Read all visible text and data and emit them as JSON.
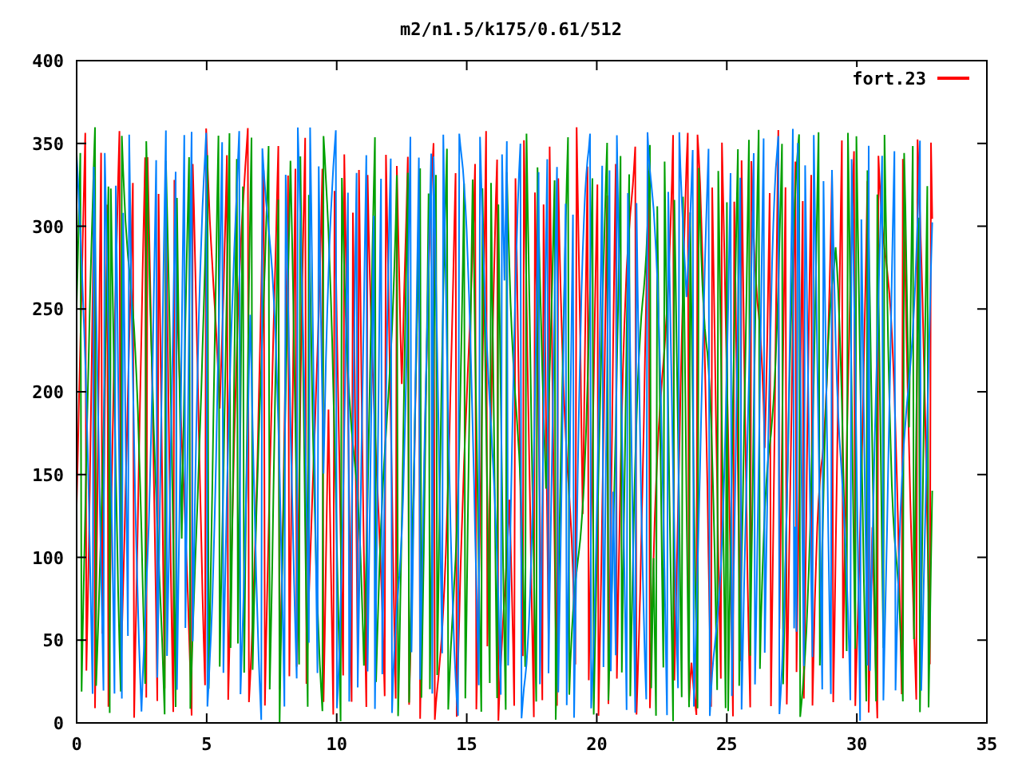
{
  "title": "m2/n1.5/k175/0.61/512",
  "legend": {
    "label": "fort.23",
    "color": "#ff0000"
  },
  "xticks": [
    "0",
    "5",
    "10",
    "15",
    "20",
    "25",
    "30",
    "35"
  ],
  "yticks": [
    "400",
    "350",
    "300",
    "250",
    "200",
    "150",
    "100",
    "50",
    "0"
  ]
}
